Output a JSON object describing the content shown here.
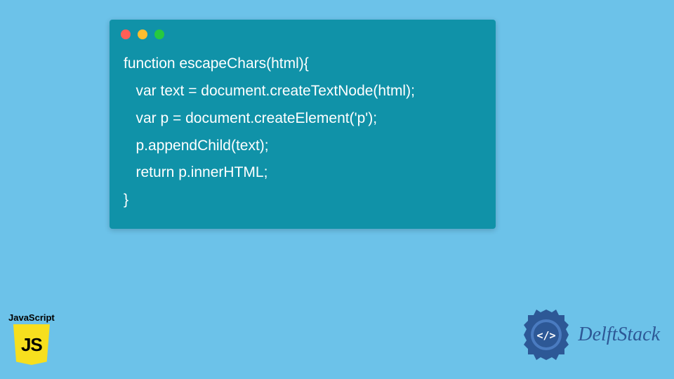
{
  "code": {
    "line1": "function escapeChars(html){",
    "line2": "   var text = document.createTextNode(html);",
    "line3": "   var p = document.createElement('p');",
    "line4": "   p.appendChild(text);",
    "line5": "   return p.innerHTML;",
    "line6": "}"
  },
  "js_badge": {
    "label": "JavaScript",
    "logo_text": "JS"
  },
  "brand": {
    "name": "DelftStack",
    "icon_symbol": "</>"
  },
  "colors": {
    "background": "#6cc2e9",
    "code_window": "#1092a8",
    "js_yellow": "#f7df1e",
    "brand_blue": "#2d5896"
  }
}
